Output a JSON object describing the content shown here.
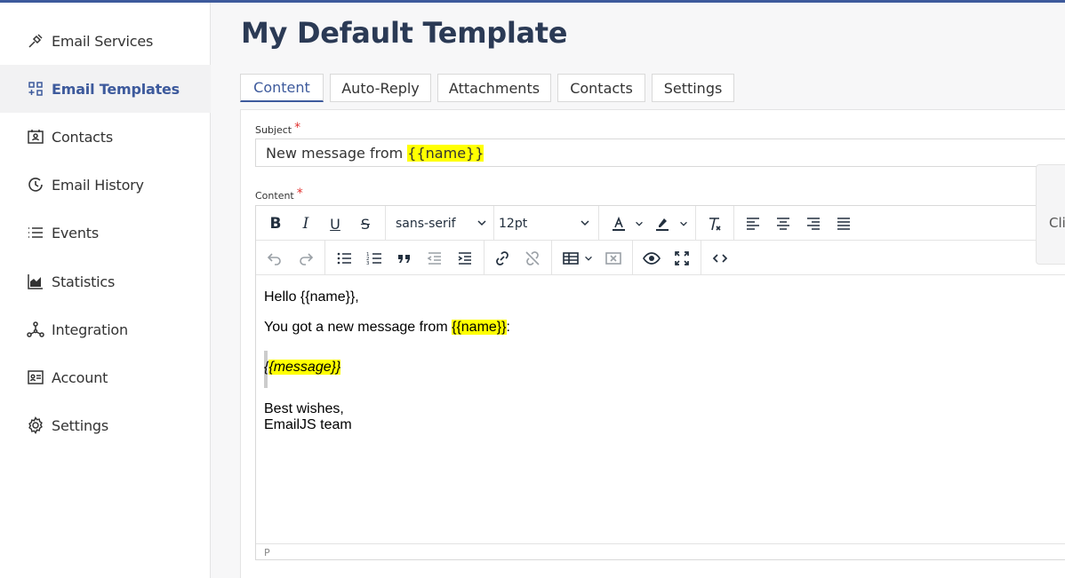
{
  "sidebar": {
    "items": [
      {
        "label": "Email Services",
        "icon": "plug-icon"
      },
      {
        "label": "Email Templates",
        "icon": "templates-icon",
        "active": true
      },
      {
        "label": "Contacts",
        "icon": "contacts-icon"
      },
      {
        "label": "Email History",
        "icon": "history-icon"
      },
      {
        "label": "Events",
        "icon": "list-icon"
      },
      {
        "label": "Statistics",
        "icon": "chart-icon"
      },
      {
        "label": "Integration",
        "icon": "integration-icon"
      },
      {
        "label": "Account",
        "icon": "id-card-icon"
      },
      {
        "label": "Settings",
        "icon": "gear-icon"
      }
    ]
  },
  "page": {
    "title": "My Default Template"
  },
  "tabs": [
    {
      "label": "Content",
      "active": true
    },
    {
      "label": "Auto-Reply"
    },
    {
      "label": "Attachments"
    },
    {
      "label": "Contacts"
    },
    {
      "label": "Settings"
    }
  ],
  "subject": {
    "label": "Subject",
    "required": "*",
    "prefix": "New message from ",
    "variable": "{{name}}"
  },
  "content": {
    "label": "Content",
    "required": "*"
  },
  "toolbar": {
    "font_family": "sans-serif",
    "font_size": "12pt"
  },
  "editor": {
    "line1": "Hello {{name}},",
    "line2_prefix": "You got a new message from ",
    "line2_var": "{{name}}",
    "line2_suffix": ":",
    "quote_open": "{",
    "quote_var": "{message}",
    "quote_close": "}",
    "sign1": "Best wishes,",
    "sign2": "EmailJS team",
    "status_path": "P"
  },
  "side_panel": {
    "label": "Cli"
  },
  "colors": {
    "accent": "#3d5a9c",
    "highlight": "#ffff00",
    "required": "#e0322f"
  }
}
